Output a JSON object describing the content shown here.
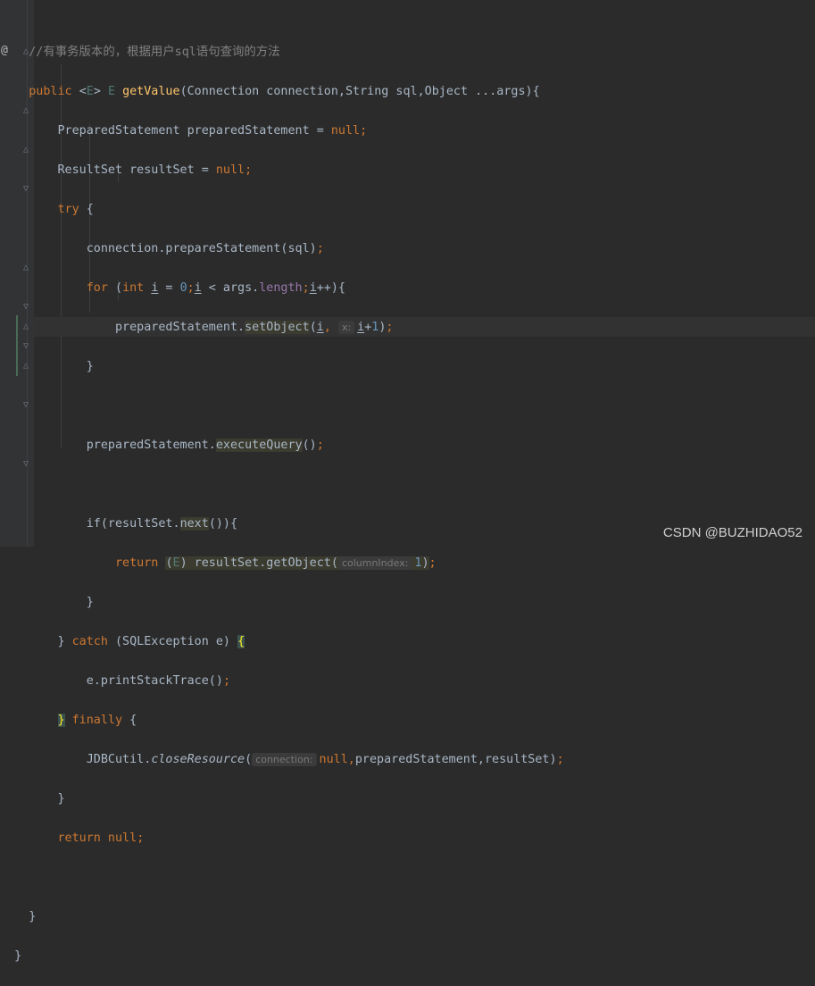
{
  "editor": {
    "comment": "//有事务版本的，根据用户sql语句查询的方法",
    "override_marker": "@",
    "watermark": "CSDN @BUZHIDAO52"
  },
  "code": {
    "sig_public": "public ",
    "sig_lt": "<",
    "sig_type_param": "E",
    "sig_gt": "> ",
    "sig_return_type": "E ",
    "sig_method": "getValue",
    "sig_params": "(Connection connection,String sql,Object ...args){",
    "l3_decl": "PreparedStatement preparedStatement = ",
    "l3_null": "null",
    "l3_semi": ";",
    "l4_decl": "ResultSet resultSet = ",
    "l4_null": "null",
    "l4_semi": ";",
    "l5_try": "try",
    "l5_brace": " {",
    "l6_prepare": "connection.prepareStatement(sql)",
    "l6_semi": ";",
    "l7_for": "for",
    "l7_paren": " (",
    "l7_int": "int",
    "l7_i1": "i",
    "l7_eq": " = ",
    "l7_zero": "0",
    "l7_semi1": ";",
    "l7_i2": "i",
    "l7_lt": " < args.",
    "l7_length": "length",
    "l7_semi2": ";",
    "l7_i3": "i",
    "l7_tail": "++){",
    "l8_ps": "preparedStatement.",
    "l8_method": "setObject",
    "l8_open": "(",
    "l8_i": "i",
    "l8_comma": ", ",
    "l8_hint": "x:",
    "l8_i2": "i",
    "l8_plus": "+",
    "l8_one": "1",
    "l8_close": ")",
    "l8_semi": ";",
    "l9_close": "}",
    "l11_ps": "preparedStatement.",
    "l11_method": "executeQuery",
    "l11_call": "()",
    "l11_semi": ";",
    "l13_if": "if(resultSet.",
    "l13_next": "next",
    "l13_tail": "()){",
    "l14_return": "return",
    "l14_space": " ",
    "l14_cast_open": "(",
    "l14_cast_type": "E",
    "l14_cast_close": ") resultSet.getObject(",
    "l14_hint": "columnIndex:",
    "l14_one": "1",
    "l14_close": ")",
    "l14_semi": ";",
    "l15_close": "}",
    "l16_close": "} ",
    "l16_catch": "catch",
    "l16_exc": " (SQLException e) ",
    "l16_brace": "{",
    "l17_print": "e.printStackTrace()",
    "l17_semi": ";",
    "l18_brace": "}",
    "l18_finally": " finally",
    "l18_open": " {",
    "l19_util": "JDBCutil.",
    "l19_method": "closeResource",
    "l19_open": "(",
    "l19_hint": "connection:",
    "l19_null": "null",
    "l19_comma": ",",
    "l19_rest": "preparedStatement,resultSet)",
    "l19_semi": ";",
    "l20_close": "}",
    "l21_return": "return",
    "l21_null": " null",
    "l21_semi": ";",
    "l23_close": "}",
    "l24_close": "}"
  },
  "colors": {
    "background": "#2b2b2b",
    "keyword": "#cc7832",
    "number": "#6897bb",
    "field": "#9876aa",
    "comment": "#808080",
    "plain": "#a9b7c6",
    "type_parameter": "#507874"
  }
}
